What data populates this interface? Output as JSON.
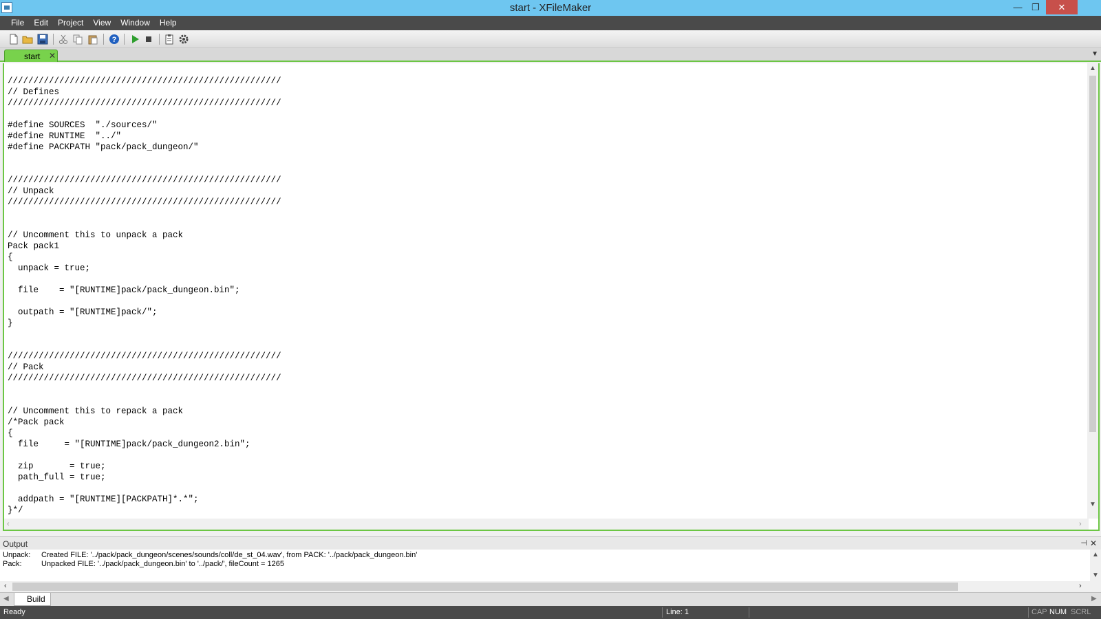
{
  "window": {
    "title": "start - XFileMaker",
    "minimize": "—",
    "restore": "❐",
    "close": "✕"
  },
  "menu": [
    "File",
    "Edit",
    "Project",
    "View",
    "Window",
    "Help"
  ],
  "toolbar": {
    "icons": [
      "new-file-icon",
      "open-folder-icon",
      "save-icon",
      "cut-icon",
      "copy-icon",
      "paste-icon",
      "help-icon",
      "run-icon",
      "stop-icon",
      "clipboard-icon",
      "settings-gear-icon"
    ],
    "colors": {
      "run": "#2e9e2e",
      "stop": "#404040",
      "help": "#2060c0"
    }
  },
  "tabs": [
    {
      "label": "start",
      "close": "✕"
    }
  ],
  "tab_menu": "▼",
  "editor": {
    "code": "/////////////////////////////////////////////////////\n// Defines\n/////////////////////////////////////////////////////\n\n#define SOURCES  \"./sources/\"\n#define RUNTIME  \"../\"\n#define PACKPATH \"pack/pack_dungeon/\"\n\n\n/////////////////////////////////////////////////////\n// Unpack\n/////////////////////////////////////////////////////\n\n\n// Uncomment this to unpack a pack\nPack pack1\n{\n  unpack = true;\n\n  file    = \"[RUNTIME]pack/pack_dungeon.bin\";\n\n  outpath = \"[RUNTIME]pack/\";\n}\n\n\n/////////////////////////////////////////////////////\n// Pack\n/////////////////////////////////////////////////////\n\n\n// Uncomment this to repack a pack\n/*Pack pack\n{\n  file     = \"[RUNTIME]pack/pack_dungeon2.bin\";\n\n  zip       = true;\n  path_full = true;\n\n  addpath = \"[RUNTIME][PACKPATH]*.*\";\n}*/"
  },
  "output": {
    "title": "Output",
    "pin": "⊣",
    "close": "✕",
    "lines": [
      {
        "source": "Unpack:",
        "text": "Created FILE: '../pack/pack_dungeon/scenes/sounds/coll/de_st_04.wav', from PACK: '../pack/pack_dungeon.bin'"
      },
      {
        "source": "Pack:",
        "text": "Unpacked FILE: '../pack/pack_dungeon.bin' to '../pack/', fileCount = 1265"
      }
    ]
  },
  "bottom_tabs": [
    {
      "label": "Build"
    }
  ],
  "status": {
    "ready": "Ready",
    "line": "Line: 1",
    "cap": "CAP",
    "num": "NUM",
    "scrl": "SCRL"
  }
}
